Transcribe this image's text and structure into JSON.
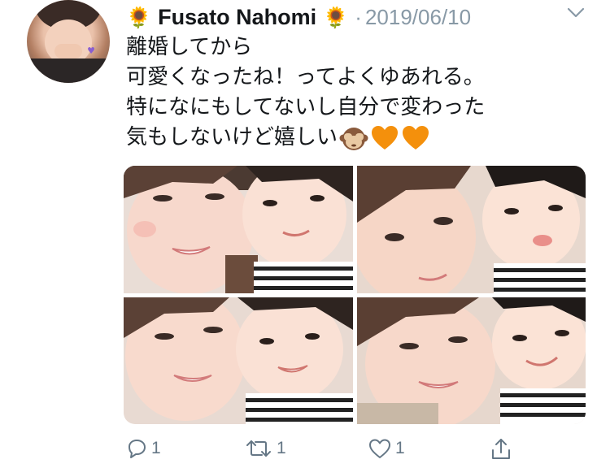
{
  "tweet": {
    "author_name": "Fusato Nahomi",
    "name_decoration": "🌻",
    "separator": "·",
    "date": "2019/06/10",
    "text_lines": [
      "離婚してから",
      "可愛くなったね！ってよくゆあれる。",
      "特になにもしてないし自分で変わった",
      "気もしないけど嬉しい"
    ],
    "trailing_emoji": [
      "see-no-evil-monkey",
      "orange-heart",
      "orange-heart"
    ]
  },
  "media": {
    "photos": [
      "photo-1",
      "photo-2",
      "photo-3",
      "photo-4"
    ]
  },
  "actions": {
    "reply_count": "1",
    "retweet_count": "1",
    "like_count": "1"
  },
  "colors": {
    "text": "#14171a",
    "muted": "#8899a6",
    "icon": "#657786",
    "heart": "#f4900c"
  }
}
